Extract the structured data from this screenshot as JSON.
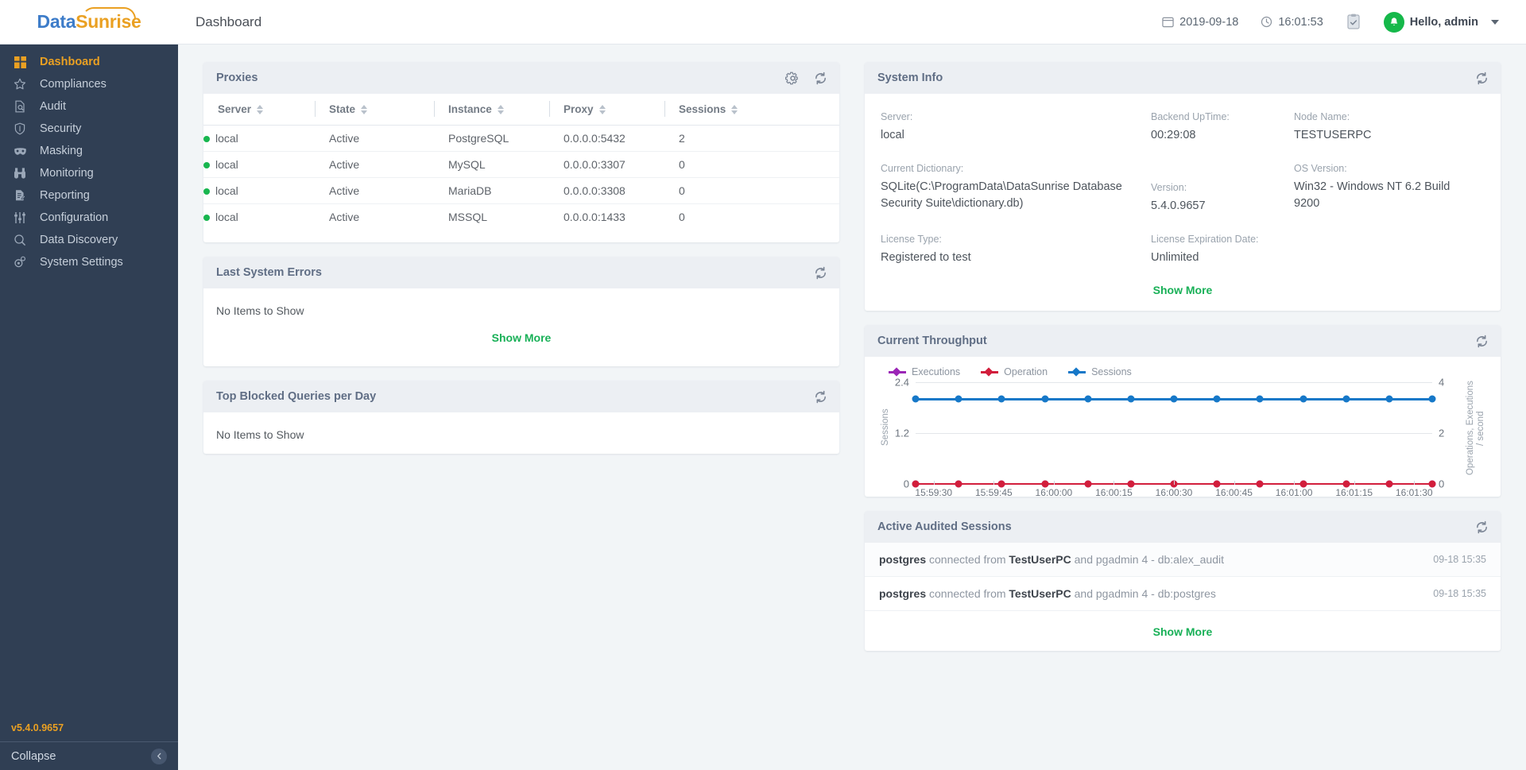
{
  "brand": {
    "part1": "Data",
    "part2": "Sunrise"
  },
  "header": {
    "page_title": "Dashboard",
    "date": "2019-09-18",
    "time": "16:01:53",
    "user_greeting": "Hello, admin"
  },
  "sidebar": {
    "items": [
      {
        "label": "Dashboard",
        "icon": "grid-icon",
        "active": true
      },
      {
        "label": "Compliances",
        "icon": "star-icon",
        "active": false
      },
      {
        "label": "Audit",
        "icon": "audit-icon",
        "active": false
      },
      {
        "label": "Security",
        "icon": "shield-icon",
        "active": false
      },
      {
        "label": "Masking",
        "icon": "mask-icon",
        "active": false
      },
      {
        "label": "Monitoring",
        "icon": "binoculars-icon",
        "active": false
      },
      {
        "label": "Reporting",
        "icon": "report-icon",
        "active": false
      },
      {
        "label": "Configuration",
        "icon": "sliders-icon",
        "active": false
      },
      {
        "label": "Data Discovery",
        "icon": "search-icon",
        "active": false
      },
      {
        "label": "System Settings",
        "icon": "gear-cog-icon",
        "active": false
      }
    ],
    "version": "v5.4.0.9657",
    "collapse_label": "Collapse"
  },
  "proxies": {
    "title": "Proxies",
    "columns": [
      "Server",
      "State",
      "Instance",
      "Proxy",
      "Sessions"
    ],
    "rows": [
      {
        "server": "local",
        "state": "Active",
        "instance": "PostgreSQL",
        "proxy": "0.0.0.0:5432",
        "sessions": "2"
      },
      {
        "server": "local",
        "state": "Active",
        "instance": "MySQL",
        "proxy": "0.0.0.0:3307",
        "sessions": "0"
      },
      {
        "server": "local",
        "state": "Active",
        "instance": "MariaDB",
        "proxy": "0.0.0.0:3308",
        "sessions": "0"
      },
      {
        "server": "local",
        "state": "Active",
        "instance": "MSSQL",
        "proxy": "0.0.0.0:1433",
        "sessions": "0"
      }
    ]
  },
  "last_system_errors": {
    "title": "Last System Errors",
    "empty_text": "No Items to Show",
    "show_more": "Show More"
  },
  "top_blocked_queries": {
    "title": "Top Blocked Queries per Day",
    "empty_text": "No Items to Show"
  },
  "system_info": {
    "title": "System Info",
    "show_more": "Show More",
    "fields": {
      "server_label": "Server:",
      "server_value": "local",
      "backend_uptime_label": "Backend UpTime:",
      "backend_uptime_value": "00:29:08",
      "node_name_label": "Node Name:",
      "node_name_value": "TESTUSERPC",
      "current_dictionary_label": "Current Dictionary:",
      "current_dictionary_value": "SQLite(C:\\ProgramData\\DataSunrise Database Security Suite\\dictionary.db)",
      "version_label": "Version:",
      "version_value": "5.4.0.9657",
      "os_version_label": "OS Version:",
      "os_version_value": "Win32 - Windows NT 6.2 Build 9200",
      "license_type_label": "License Type:",
      "license_type_value": "Registered to test",
      "license_expiration_label": "License Expiration Date:",
      "license_expiration_value": "Unlimited"
    }
  },
  "current_throughput": {
    "title": "Current Throughput"
  },
  "chart_data": {
    "type": "line",
    "title": "Current Throughput",
    "xlabel": "",
    "ylabel": "Sessions",
    "y2label": "Operations, Executions / second",
    "ylim": [
      0,
      2.4
    ],
    "yticks": [
      0,
      1.2,
      2.4
    ],
    "y2lim": [
      0,
      4
    ],
    "y2ticks": [
      0,
      2,
      4
    ],
    "grid": true,
    "legend_position": "top-left",
    "x": [
      "15:59:30",
      "15:59:45",
      "16:00:00",
      "16:00:15",
      "16:00:30",
      "16:00:45",
      "16:01:00",
      "16:01:15",
      "16:01:30"
    ],
    "xticks": [
      "15:59:30",
      "15:59:45",
      "16:00:00",
      "16:00:15",
      "16:00:30",
      "16:00:45",
      "16:01:00",
      "16:01:15",
      "16:01:30"
    ],
    "series": [
      {
        "name": "Executions",
        "color": "#9b26b6",
        "axis": "right",
        "values": [
          0,
          0,
          0,
          0,
          0,
          0,
          0,
          0,
          0,
          0,
          0,
          0,
          0
        ]
      },
      {
        "name": "Operation",
        "color": "#d21e3c",
        "axis": "right",
        "values": [
          0,
          0,
          0,
          0,
          0,
          0,
          0,
          0,
          0,
          0,
          0,
          0,
          0
        ]
      },
      {
        "name": "Sessions",
        "color": "#1678c8",
        "axis": "left",
        "values": [
          2,
          2,
          2,
          2,
          2,
          2,
          2,
          2,
          2,
          2,
          2,
          2,
          2
        ]
      }
    ],
    "point_count": 13
  },
  "active_sessions": {
    "title": "Active Audited Sessions",
    "show_more": "Show More",
    "rows": [
      {
        "user": "postgres",
        "mid": "connected from",
        "host": "TestUserPC",
        "tail": "and pgadmin 4 - db:alex_audit",
        "time": "09-18 15:35"
      },
      {
        "user": "postgres",
        "mid": "connected from",
        "host": "TestUserPC",
        "tail": "and pgadmin 4 - db:postgres",
        "time": "09-18 15:35"
      }
    ]
  }
}
